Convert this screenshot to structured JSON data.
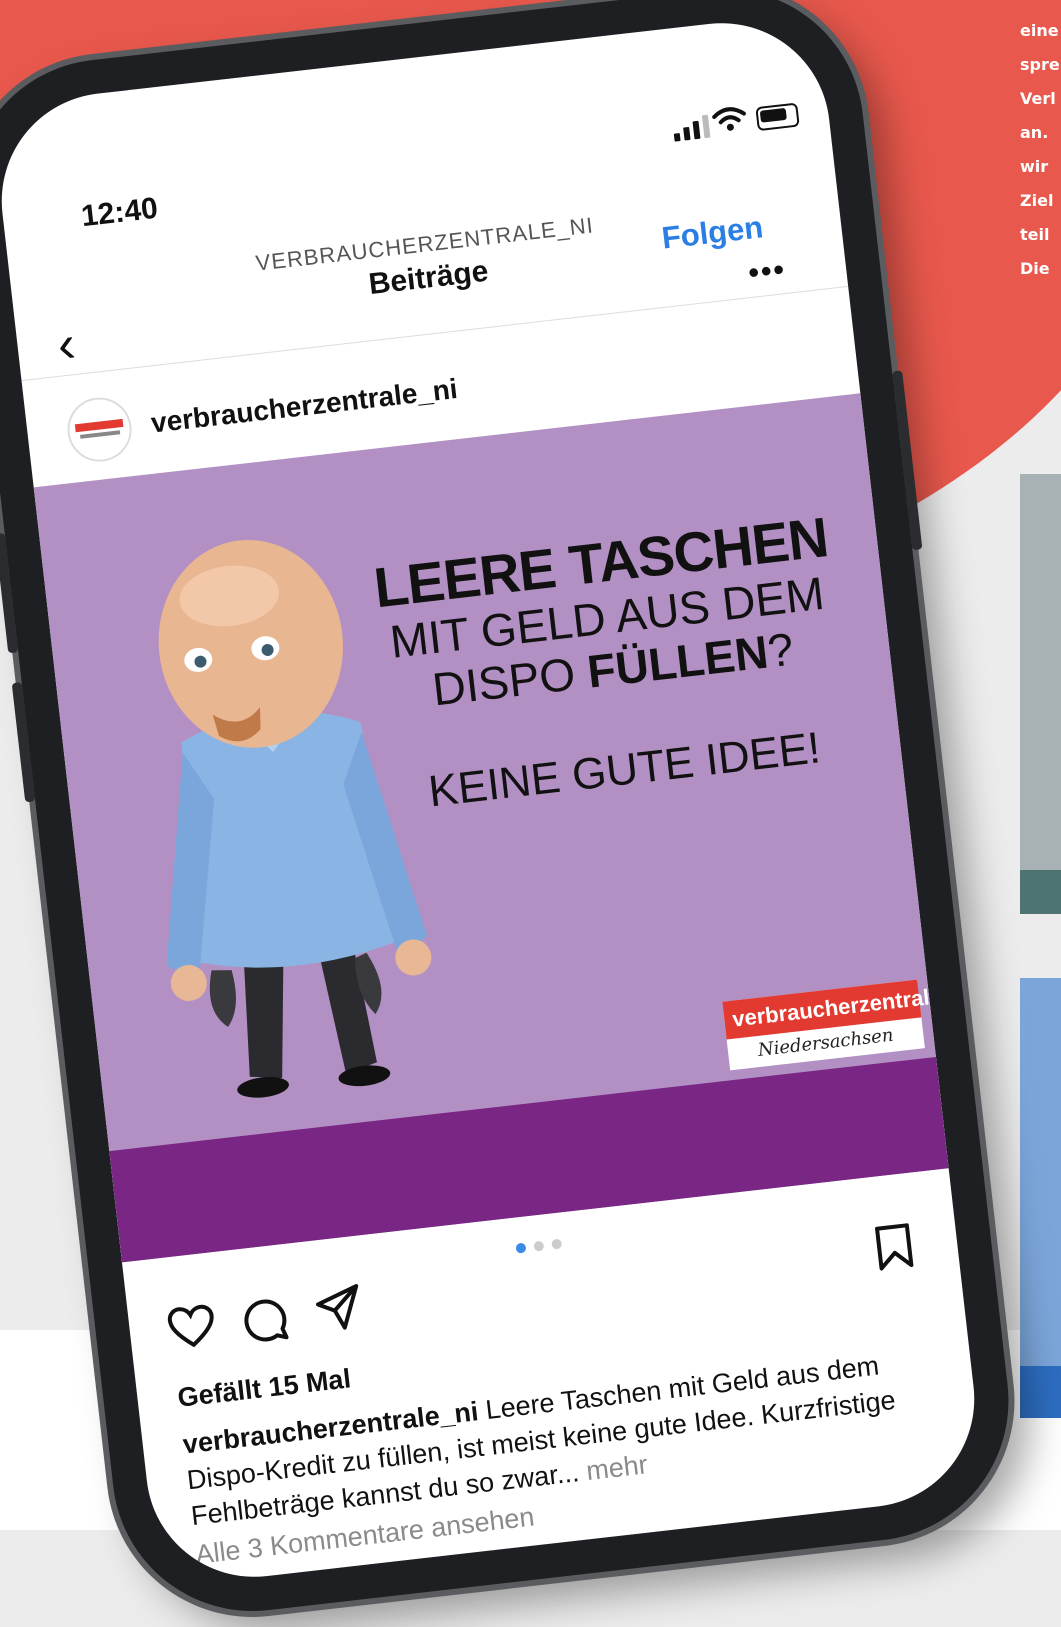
{
  "side_text_lines": [
    "eine",
    "spre",
    "Verl",
    "an.",
    "wir",
    "Ziel",
    "teil",
    "Die"
  ],
  "status_bar": {
    "time": "12:40"
  },
  "nav": {
    "subtitle": "VERBRAUCHERZENTRALE_NI",
    "title": "Beiträge",
    "follow_label": "Folgen",
    "more_label": "•••"
  },
  "post": {
    "username": "verbraucherzentrale_ni",
    "image": {
      "line1": "LEERE TASCHEN",
      "line2": "MIT GELD AUS DEM",
      "line3_prefix": "DISPO ",
      "line3_bold": "FÜLLEN",
      "line3_suffix": "?",
      "line4": "KEINE GUTE IDEE!",
      "logo_top": "verbraucherzentrale",
      "logo_bottom": "Niedersachsen"
    },
    "carousel": {
      "count": 3,
      "active": 0
    },
    "likes": "Gefällt 15 Mal",
    "caption_user": "verbraucherzentrale_ni",
    "caption_text": " Leere Taschen mit Geld aus dem Dispo-Kredit zu füllen, ist meist keine gute Idee. Kurzfristige Fehlbeträge kannst du so zwar...",
    "caption_more": " mehr",
    "comments_link": "Alle 3 Kommentare ansehen"
  },
  "colors": {
    "brand_red": "#e8584c",
    "post_purple": "#b390c4",
    "band_purple": "#7a2684",
    "link_blue": "#2b7fe4"
  }
}
